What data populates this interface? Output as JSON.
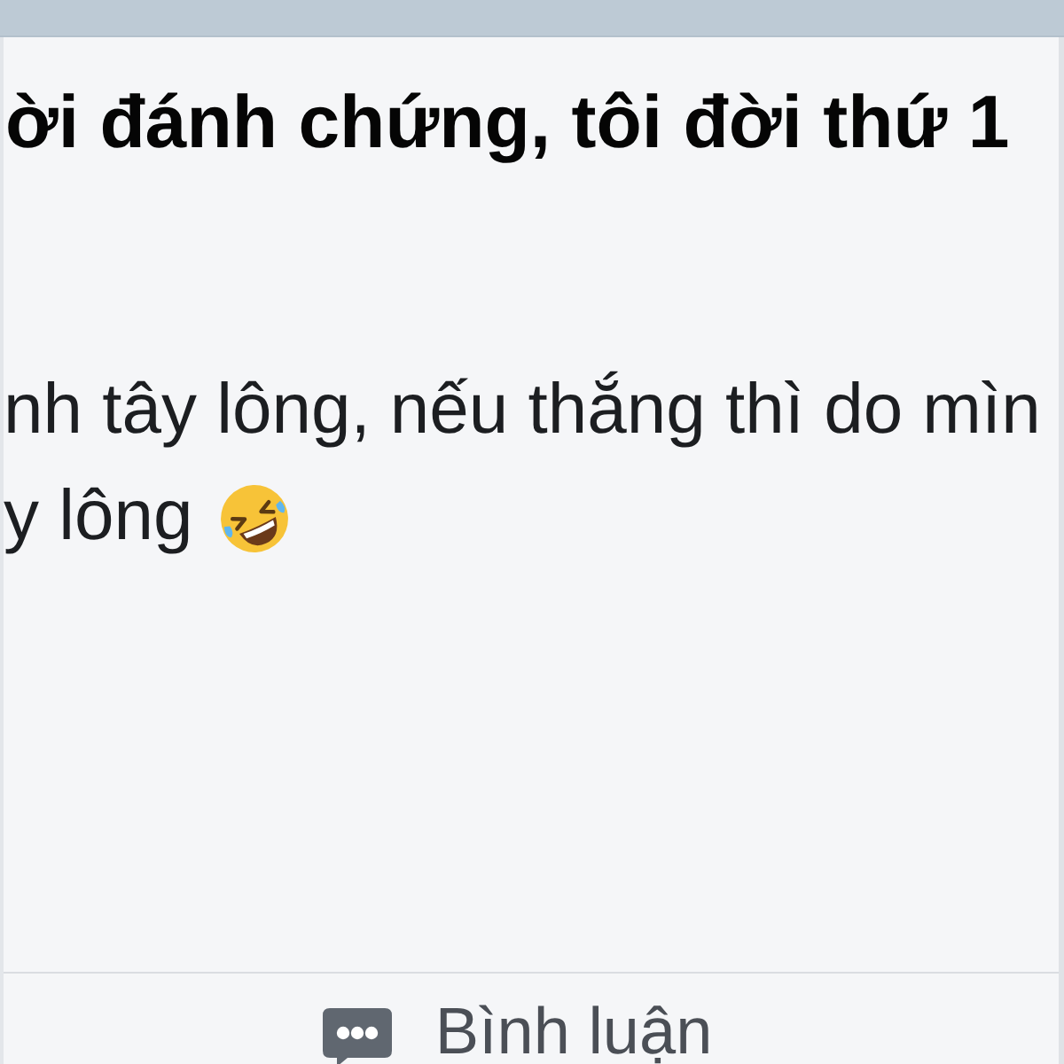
{
  "post": {
    "title": "ời đánh chứng, tôi đời thứ 1",
    "lines": [
      {
        "text": "nh tây lông, nếu thắng thì do mìn",
        "emoji": false
      },
      {
        "text": "y lông",
        "emoji": true
      }
    ]
  },
  "actions": [
    {
      "kind": "comment",
      "label": "Bình luận"
    }
  ]
}
